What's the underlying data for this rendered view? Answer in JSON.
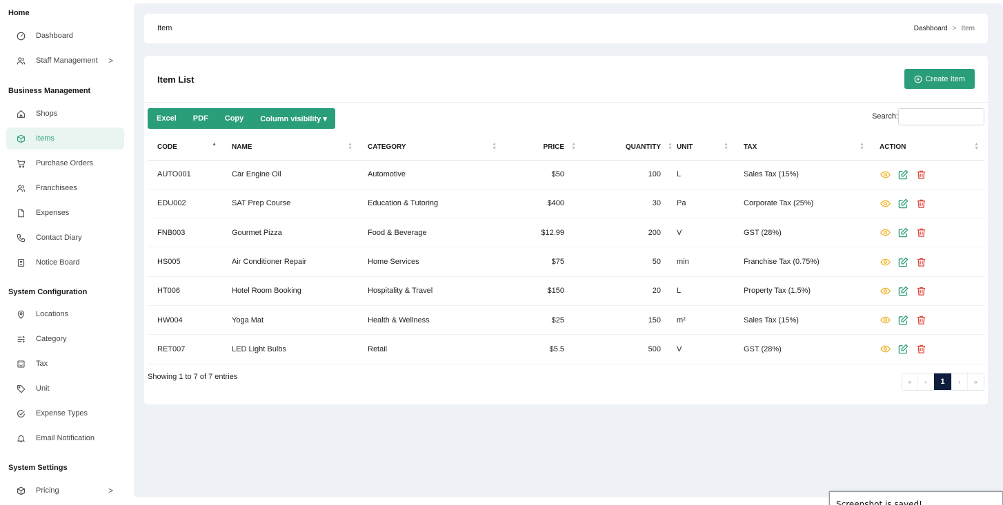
{
  "sidebar": {
    "sections": [
      {
        "title": "Home"
      },
      {
        "title": "Business Management"
      },
      {
        "title": "System Configuration"
      },
      {
        "title": "System Settings"
      }
    ],
    "items": [
      {
        "label": "Dashboard"
      },
      {
        "label": "Staff Management",
        "chevron": ">"
      },
      {
        "label": "Shops"
      },
      {
        "label": "Items"
      },
      {
        "label": "Purchase Orders"
      },
      {
        "label": "Franchisees"
      },
      {
        "label": "Expenses"
      },
      {
        "label": "Contact Diary"
      },
      {
        "label": "Notice Board"
      },
      {
        "label": "Locations"
      },
      {
        "label": "Category"
      },
      {
        "label": "Tax"
      },
      {
        "label": "Unit"
      },
      {
        "label": "Expense Types"
      },
      {
        "label": "Email Notification"
      },
      {
        "label": "Pricing",
        "chevron": ">"
      }
    ]
  },
  "header": {
    "title": "Item",
    "breadcrumb": {
      "root": "Dashboard",
      "sep": ">",
      "current": "Item"
    }
  },
  "list": {
    "title": "Item List",
    "create_label": "Create Item",
    "export_buttons": {
      "excel": "Excel",
      "pdf": "PDF",
      "copy": "Copy",
      "colvis": "Column visibility ▾"
    },
    "search_label": "Search:",
    "search_value": "",
    "columns": {
      "code": "CODE",
      "name": "NAME",
      "category": "CATEGORY",
      "price": "PRICE",
      "quantity": "QUANTITY",
      "unit": "UNIT",
      "tax": "TAX",
      "action": "ACTION"
    },
    "rows": [
      {
        "code": "AUTO001",
        "name": "Car Engine Oil",
        "category": "Automotive",
        "price": "$50",
        "quantity": "100",
        "unit": "L",
        "tax": "Sales Tax (15%)"
      },
      {
        "code": "EDU002",
        "name": "SAT Prep Course",
        "category": "Education & Tutoring",
        "price": "$400",
        "quantity": "30",
        "unit": "Pa",
        "tax": "Corporate Tax (25%)"
      },
      {
        "code": "FNB003",
        "name": "Gourmet Pizza",
        "category": "Food & Beverage",
        "price": "$12.99",
        "quantity": "200",
        "unit": "V",
        "tax": "GST (28%)"
      },
      {
        "code": "HS005",
        "name": "Air Conditioner Repair",
        "category": "Home Services",
        "price": "$75",
        "quantity": "50",
        "unit": "min",
        "tax": "Franchise Tax (0.75%)"
      },
      {
        "code": "HT006",
        "name": "Hotel Room Booking",
        "category": "Hospitality & Travel",
        "price": "$150",
        "quantity": "20",
        "unit": "L",
        "tax": "Property Tax (1.5%)"
      },
      {
        "code": "HW004",
        "name": "Yoga Mat",
        "category": "Health & Wellness",
        "price": "$25",
        "quantity": "150",
        "unit": "m²",
        "tax": "Sales Tax (15%)"
      },
      {
        "code": "RET007",
        "name": "LED Light Bulbs",
        "category": "Retail",
        "price": "$5.5",
        "quantity": "500",
        "unit": "V",
        "tax": "GST (28%)"
      }
    ],
    "info": "Showing 1 to 7 of 7 entries",
    "pagination": {
      "first": "«",
      "prev": "‹",
      "current": "1",
      "next": "›",
      "last": "»"
    }
  },
  "toast": {
    "text": "Screenshot is saved!"
  },
  "colors": {
    "accent": "#2a9d7a",
    "active_bg": "#e9f5f0",
    "page_active": "#0f1e3d",
    "view_icon": "#f0b429",
    "edit_icon": "#2a9d7a",
    "delete_icon": "#e0453a"
  }
}
